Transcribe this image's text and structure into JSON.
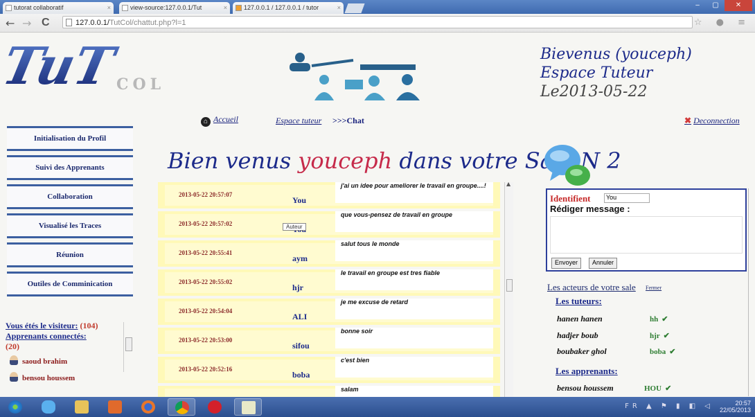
{
  "browser": {
    "tabs": [
      {
        "title": "tutorat collaboratif",
        "close": "×"
      },
      {
        "title": "view-source:127.0.0.1/Tut",
        "close": "×"
      },
      {
        "title": "127.0.0.1 / 127.0.0.1 / tutor",
        "close": "×"
      }
    ],
    "window_buttons": {
      "minimize": "–",
      "maximize": "▢",
      "close": "✕"
    },
    "nav": {
      "back": "←",
      "forward": "→",
      "reload": "C"
    },
    "url_host": "127.0.0.1/",
    "url_rest": "TutCol/chattut.php?l=1",
    "toolbar_icons": "☆ ● ≡"
  },
  "header": {
    "logo_text": "TuT",
    "logo_sub": "COL",
    "welcome_line1": "Bievenus (youceph)",
    "welcome_line2": "Espace Tuteur",
    "welcome_date": "Le2013-05-22"
  },
  "topnav": {
    "home_icon": "⌂",
    "accueil": "Accueil",
    "espace": "Espace tuteur",
    "chat": ">>>Chat",
    "logout_icon": "✖",
    "logout": "Deconnection"
  },
  "sidebar": {
    "items": [
      {
        "label": "Initialisation du Profil"
      },
      {
        "label": "Suivi des Apprenants"
      },
      {
        "label": "Collaboration"
      },
      {
        "label": "Visualisé les Traces"
      },
      {
        "label": "Réunion"
      },
      {
        "label": "Outiles de Comminication"
      }
    ],
    "visitor_label": "Vous étés le visiteur:",
    "visitor_count": "(104)",
    "connected_label": "Apprenants connectés:",
    "connected_count": "(20)",
    "users": [
      "saoud brahim",
      "bensou houssem"
    ]
  },
  "chat": {
    "title_pre": "Bien venus ",
    "title_name": "youceph",
    "title_post": " dans votre Sale N 2",
    "tooltip": "Auteur",
    "messages": [
      {
        "time": "2013-05-22 20:57:07",
        "user": "You",
        "text": "j'ai un idee pour ameliorer le travail en groupe....!"
      },
      {
        "time": "2013-05-22 20:57:02",
        "user": "You",
        "text": "que vous-pensez de travail en groupe"
      },
      {
        "time": "2013-05-22 20:55:41",
        "user": "aym",
        "text": "salut tous le monde"
      },
      {
        "time": "2013-05-22 20:55:02",
        "user": "hjr",
        "text": "le travail en groupe est tres fiable"
      },
      {
        "time": "2013-05-22 20:54:04",
        "user": "ALI",
        "text": "je me excuse de retard"
      },
      {
        "time": "2013-05-22 20:53:00",
        "user": "sifou",
        "text": "bonne soir"
      },
      {
        "time": "2013-05-22 20:52:16",
        "user": "boba",
        "text": "c'est bien"
      },
      {
        "time": "",
        "user": "",
        "text": "salam"
      }
    ]
  },
  "compose": {
    "id_label": "Identifient",
    "id_value": "You",
    "msg_label": "Rédiger message :",
    "send": "Envoyer",
    "cancel": "Annuler"
  },
  "actors": {
    "title": "Les acteurs de votre sale",
    "close": "Fermer",
    "tutors_label": "Les tuteurs:",
    "tutors": [
      {
        "name": "hanen hanen",
        "nick": "hh"
      },
      {
        "name": "hadjer boub",
        "nick": "hjr"
      },
      {
        "name": "boubaker ghol",
        "nick": "boba"
      }
    ],
    "learners_label": "Les apprenants:",
    "learners": [
      {
        "name": "bensou houssem",
        "nick": "HOU"
      }
    ],
    "check": "✔"
  },
  "taskbar": {
    "tray_icons": "FR ▲ ⚑ ▮ ◧ ◁",
    "time": "20:57",
    "date": "22/05/2013"
  }
}
